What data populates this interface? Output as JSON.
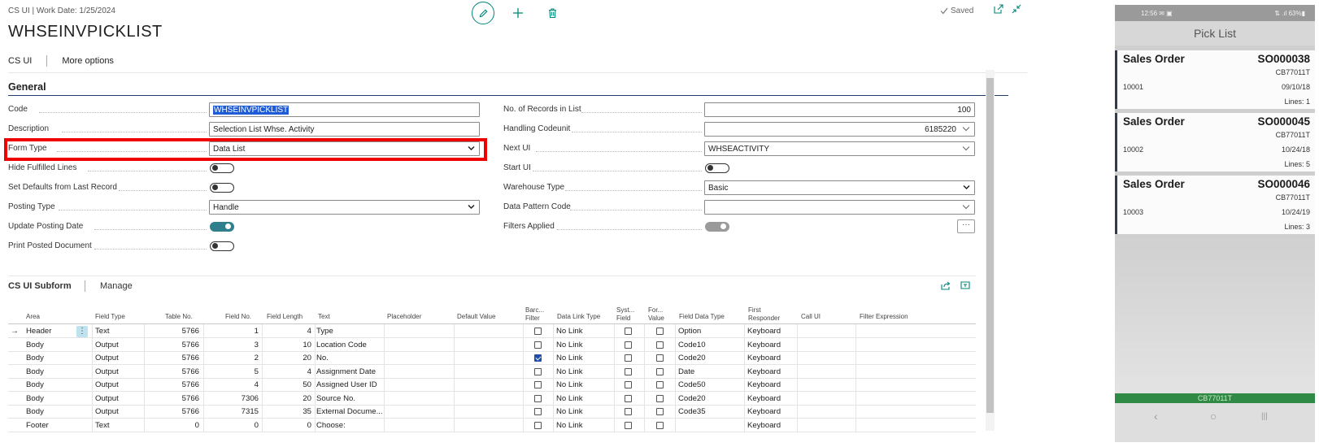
{
  "app": {
    "context": "CS UI | Work Date: 1/25/2024",
    "title": "WHSEINVPICKLIST",
    "saved_label": "Saved"
  },
  "actions": {
    "cs_ui": "CS UI",
    "more_options": "More options"
  },
  "general": {
    "heading": "General",
    "left_fields": {
      "code_label": "Code",
      "code_value": "WHSEINVPICKLIST",
      "description_label": "Description",
      "description_value": "Selection List Whse. Activity",
      "form_type_label": "Form Type",
      "form_type_value": "Data List",
      "hide_fulfilled_label": "Hide Fulfilled Lines",
      "hide_fulfilled_on": false,
      "set_defaults_label": "Set Defaults from Last Record",
      "set_defaults_on": false,
      "posting_type_label": "Posting Type",
      "posting_type_value": "Handle",
      "update_posting_date_label": "Update Posting Date",
      "update_posting_date_on": true,
      "print_posted_label": "Print Posted Document",
      "print_posted_on": false
    },
    "right_fields": {
      "records_label": "No. of Records in List",
      "records_value": "100",
      "codeunit_label": "Handling Codeunit",
      "codeunit_value": "6185220",
      "next_ui_label": "Next UI",
      "next_ui_value": "WHSEACTIVITY",
      "start_ui_label": "Start UI",
      "start_ui_on": false,
      "warehouse_type_label": "Warehouse Type",
      "warehouse_type_value": "Basic",
      "data_pattern_label": "Data Pattern Code",
      "data_pattern_value": "",
      "filters_label": "Filters Applied",
      "filters_on": true,
      "filters_button": "···"
    }
  },
  "subform": {
    "title": "CS UI Subform",
    "manage": "Manage",
    "columns": {
      "area": "Area",
      "field_type": "Field Type",
      "table_no": "Table No.",
      "field_no": "Field No.",
      "field_length": "Field Length",
      "text": "Text",
      "placeholder": "Placeholder",
      "default_value": "Default Value",
      "barcode_filter_1": "Barc...",
      "barcode_filter_2": "Filter",
      "data_link_type": "Data Link Type",
      "system_field_1": "Syst...",
      "system_field_2": "Field",
      "format_value_1": "For...",
      "format_value_2": "Value",
      "field_data_type": "Field Data Type",
      "first_responder_1": "First",
      "first_responder_2": "Responder",
      "call_ui": "Call UI",
      "filter_expression": "Filter Expression"
    },
    "rows": [
      {
        "area": "Header",
        "field_type": "Text",
        "table_no": "5766",
        "field_no": "1",
        "field_length": "4",
        "text": "Type",
        "barcode": false,
        "link": "No Link",
        "system": false,
        "format": false,
        "data_type": "Option",
        "responder": "Keyboard"
      },
      {
        "area": "Body",
        "field_type": "Output",
        "table_no": "5766",
        "field_no": "3",
        "field_length": "10",
        "text": "Location Code",
        "barcode": false,
        "link": "No Link",
        "system": false,
        "format": false,
        "data_type": "Code10",
        "responder": "Keyboard"
      },
      {
        "area": "Body",
        "field_type": "Output",
        "table_no": "5766",
        "field_no": "2",
        "field_length": "20",
        "text": "No.",
        "barcode": true,
        "link": "No Link",
        "system": false,
        "format": false,
        "data_type": "Code20",
        "responder": "Keyboard"
      },
      {
        "area": "Body",
        "field_type": "Output",
        "table_no": "5766",
        "field_no": "5",
        "field_length": "4",
        "text": "Assignment Date",
        "barcode": false,
        "link": "No Link",
        "system": false,
        "format": false,
        "data_type": "Date",
        "responder": "Keyboard"
      },
      {
        "area": "Body",
        "field_type": "Output",
        "table_no": "5766",
        "field_no": "4",
        "field_length": "50",
        "text": "Assigned User ID",
        "barcode": false,
        "link": "No Link",
        "system": false,
        "format": false,
        "data_type": "Code50",
        "responder": "Keyboard"
      },
      {
        "area": "Body",
        "field_type": "Output",
        "table_no": "5766",
        "field_no": "7306",
        "field_length": "20",
        "text": "Source No.",
        "barcode": false,
        "link": "No Link",
        "system": false,
        "format": false,
        "data_type": "Code20",
        "responder": "Keyboard"
      },
      {
        "area": "Body",
        "field_type": "Output",
        "table_no": "5766",
        "field_no": "7315",
        "field_length": "35",
        "text": "External Docume...",
        "barcode": false,
        "link": "No Link",
        "system": false,
        "format": false,
        "data_type": "Code35",
        "responder": "Keyboard"
      },
      {
        "area": "Footer",
        "field_type": "Text",
        "table_no": "0",
        "field_no": "0",
        "field_length": "0",
        "text": "Choose:",
        "barcode": false,
        "link": "No Link",
        "system": false,
        "format": false,
        "data_type": "",
        "responder": "Keyboard"
      }
    ]
  },
  "phone": {
    "status_left": "12:56 ✉ ▣",
    "status_right": "⇅ .ıl 63%▮",
    "header": "Pick List",
    "cards": [
      {
        "title": "Sales Order",
        "number": "SO000038",
        "code": "CB77011T",
        "customer": "10001",
        "date": "09/10/18",
        "lines": "Lines: 1"
      },
      {
        "title": "Sales Order",
        "number": "SO000045",
        "code": "CB77011T",
        "customer": "10002",
        "date": "10/24/18",
        "lines": "Lines: 5"
      },
      {
        "title": "Sales Order",
        "number": "SO000046",
        "code": "CB77011T",
        "customer": "10003",
        "date": "10/24/19",
        "lines": "Lines: 3"
      }
    ],
    "footer": "CB77011T",
    "nav_back": "‹",
    "nav_home": "○",
    "nav_recent": "|||"
  },
  "colors": {
    "accent_teal": "#00857a",
    "highlight_red": "#ee0000",
    "toggle_on": "#2f7f8d",
    "phone_footer": "#2e8a44"
  }
}
